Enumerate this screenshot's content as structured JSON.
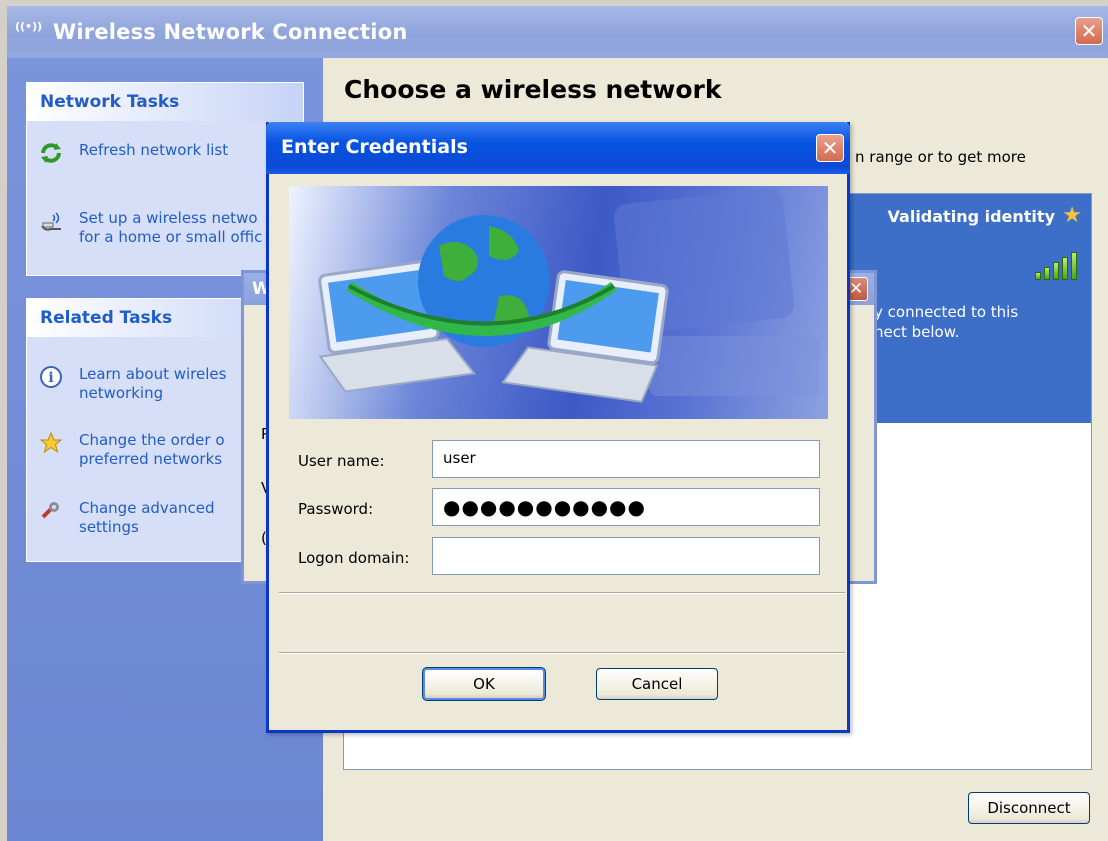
{
  "window": {
    "title": "Wireless Network Connection",
    "close_label": "✕"
  },
  "left_pane": {
    "network_tasks": {
      "heading": "Network Tasks",
      "items": [
        {
          "label": "Refresh network list",
          "icon": "refresh-icon"
        },
        {
          "label": "Set up a wireless netwo\nfor a home or small offic",
          "icon": "wireless-setup-icon"
        }
      ]
    },
    "related_tasks": {
      "heading": "Related Tasks",
      "items": [
        {
          "label": "Learn about wireles\nnetworking",
          "icon": "info-icon"
        },
        {
          "label": "Change the order o\npreferred networks",
          "icon": "star-icon"
        },
        {
          "label": "Change advanced\nsettings",
          "icon": "settings-icon"
        }
      ]
    }
  },
  "main": {
    "heading": "Choose a wireless network",
    "partial_text": "n range or to get more",
    "selected_network": {
      "status": "Validating identity",
      "signal_level": 1.0,
      "description": "y connected to this\nnect below."
    },
    "disconnect_label": "Disconnect"
  },
  "background_dialog": {
    "title_fragment": "W",
    "fragments": [
      "P",
      "V",
      "("
    ]
  },
  "credentials_dialog": {
    "title": "Enter Credentials",
    "close_label": "✕",
    "fields": {
      "username_label": "User name:",
      "username_value": "user",
      "password_label": "Password:",
      "password_value": "●●●●●●●●●●●",
      "domain_label": "Logon domain:",
      "domain_value": ""
    },
    "ok_label": "OK",
    "cancel_label": "Cancel"
  }
}
